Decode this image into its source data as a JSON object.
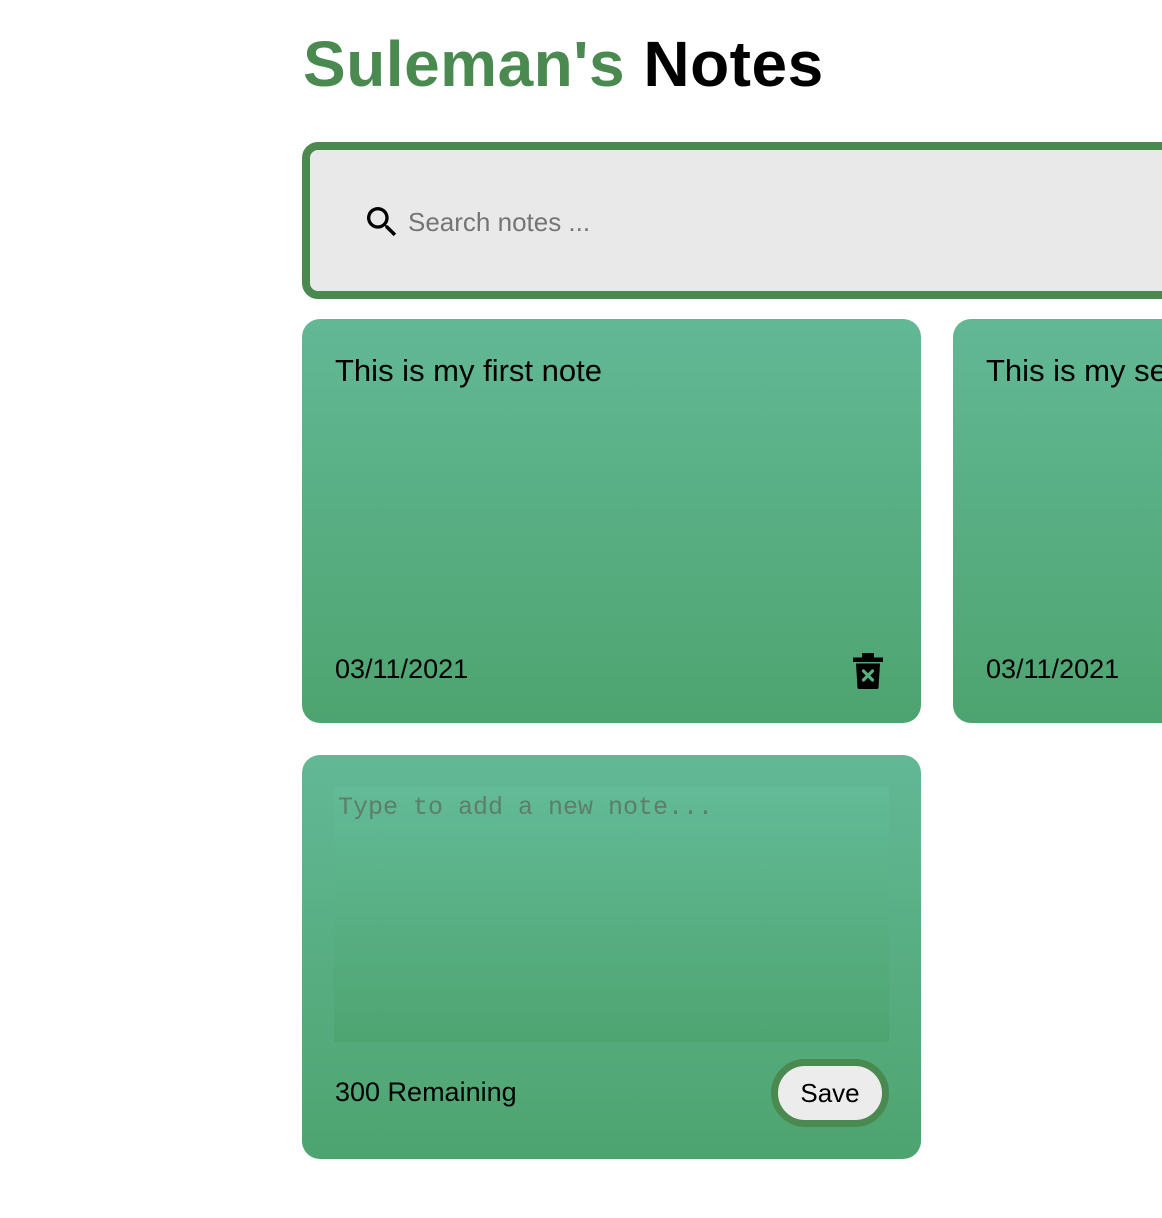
{
  "header": {
    "name": "Suleman's",
    "title": "Notes"
  },
  "search": {
    "placeholder": "Search notes ...",
    "icon": "search-icon"
  },
  "notes": [
    {
      "text": "This is my first note",
      "date": "03/11/2021",
      "delete_icon": "trash-icon"
    },
    {
      "text": "This is my second note",
      "date": "03/11/2021",
      "delete_icon": "trash-icon"
    }
  ],
  "new_note": {
    "placeholder": "Type to add a new note...",
    "remaining": "300 Remaining",
    "save_label": "Save"
  },
  "colors": {
    "brand_green": "#4a8a50",
    "note_gradient_top": "#62b895",
    "note_gradient_bottom": "#4ea46f",
    "search_background": "#e9e9e9"
  }
}
